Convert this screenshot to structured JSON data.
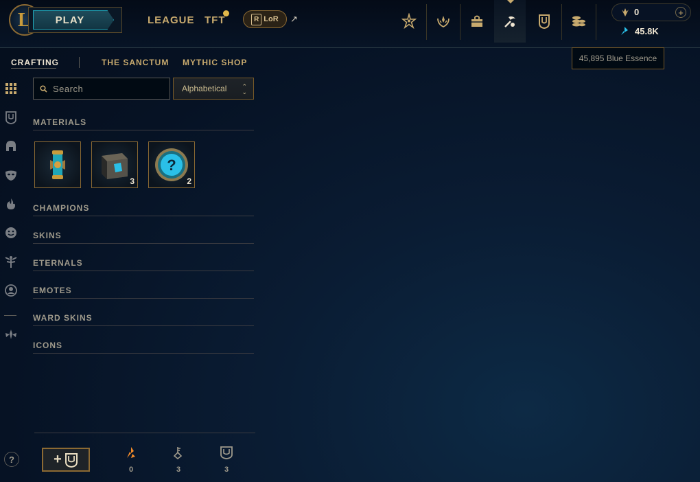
{
  "header": {
    "logo_letter": "L",
    "play_label": "PLAY",
    "nav": [
      "LEAGUE",
      "TFT"
    ],
    "lor_label": "LoR",
    "lor_badge": "R",
    "external_arrow": "↗",
    "icons": [
      "profile-icon",
      "challenges-icon",
      "collection-icon",
      "loot-icon",
      "ward-icon",
      "store-icon"
    ],
    "active_icon": "loot-icon"
  },
  "wallet": {
    "rp_value": "0",
    "plus_label": "+",
    "be_value": "45.8K",
    "tooltip": "45,895 Blue Essence"
  },
  "subtabs": {
    "items": [
      "CRAFTING",
      "THE SANCTUM",
      "MYTHIC SHOP"
    ],
    "active": "CRAFTING"
  },
  "toolbar": {
    "search_placeholder": "Search",
    "sort_value": "Alphabetical",
    "sort_chevron_up": "⌃",
    "sort_chevron_down": "⌄"
  },
  "sections": {
    "materials": "MATERIALS",
    "champions": "CHAMPIONS",
    "skins": "SKINS",
    "eternals": "ETERNALS",
    "emotes": "EMOTES",
    "ward_skins": "WARD SKINS",
    "icons": "ICONS"
  },
  "materials": [
    {
      "icon": "capsule-icon",
      "count": ""
    },
    {
      "icon": "chest-icon",
      "count": "3"
    },
    {
      "icon": "mystery-orb-icon",
      "count": "2"
    }
  ],
  "sidebar_icons": [
    "grid-icon",
    "ward-icon",
    "helmet-icon",
    "mask-icon",
    "flame-icon",
    "emote-icon",
    "tft-icon",
    "profile-icon",
    "eternal-icon"
  ],
  "footer": {
    "help_label": "?",
    "add_plus": "+",
    "currencies": [
      {
        "icon": "orange-essence-icon",
        "count": "0"
      },
      {
        "icon": "key-icon",
        "count": "3"
      },
      {
        "icon": "ward-token-icon",
        "count": "3"
      }
    ]
  },
  "colors": {
    "gold": "#c8aa6e",
    "teal": "#1fa6b8",
    "background": "#061224",
    "orange_essence": "#f08a2b",
    "blue_essence": "#2ac0e8"
  }
}
